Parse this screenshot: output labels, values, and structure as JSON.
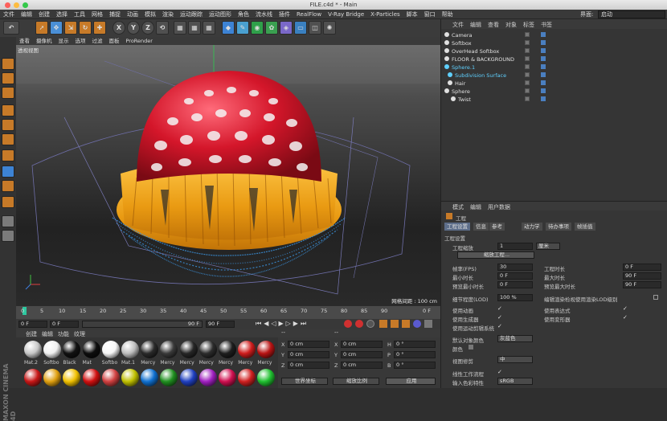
{
  "window": {
    "title": "FILE.c4d * - Main"
  },
  "menu": [
    "文件",
    "编辑",
    "创建",
    "选择",
    "工具",
    "网格",
    "捕捉",
    "动画",
    "模拟",
    "渲染",
    "运动跟踪",
    "运动图形",
    "角色",
    "流水线",
    "插件",
    "RealFlow",
    "V-Ray Bridge",
    "X-Particles",
    "脚本",
    "窗口",
    "帮助"
  ],
  "layout": {
    "label": "界面:",
    "value": "启动"
  },
  "viewport": {
    "menu": [
      "查看",
      "摄像机",
      "显示",
      "选项",
      "过滤",
      "面板",
      "ProRender"
    ],
    "name": "透视视图",
    "grid_label": "网格间距 : 100 cm"
  },
  "timeline": {
    "ticks": [
      "0",
      "5",
      "10",
      "15",
      "20",
      "25",
      "30",
      "35",
      "40",
      "45",
      "50",
      "55",
      "60",
      "65",
      "70",
      "75",
      "80",
      "85",
      "90"
    ],
    "end": "0 F"
  },
  "transport": {
    "start": "0 F",
    "current": "0 F",
    "end": "90 F",
    "end2": "90 F"
  },
  "materials": {
    "menu": [
      "创建",
      "编辑",
      "功能",
      "纹理"
    ],
    "items": [
      {
        "name": "Mat.2",
        "color": "#c8c8c8"
      },
      {
        "name": "Softbo",
        "color": "#f0f0f0"
      },
      {
        "name": "Black",
        "color": "#111111"
      },
      {
        "name": "Mat",
        "color": "#0d0d0d"
      },
      {
        "name": "Softbo",
        "color": "#f6f6f6"
      },
      {
        "name": "Mat.1",
        "color": "#bdbdbd"
      },
      {
        "name": "Mercy",
        "color": "#2a2a2a"
      },
      {
        "name": "Mercy",
        "color": "#3a3a3a"
      },
      {
        "name": "Mercy",
        "color": "#262626"
      },
      {
        "name": "Mercy",
        "color": "#2c2c2c"
      },
      {
        "name": "Mercy",
        "color": "#1e1e1e"
      },
      {
        "name": "Mercy",
        "color": "#d01d1d"
      },
      {
        "name": "Mercy",
        "color": "#b91414"
      }
    ],
    "row2": [
      "#c81717",
      "#e0a010",
      "#f0c000",
      "#d01010",
      "#d04040",
      "#c0c000",
      "#1070d0",
      "#209020",
      "#2040c0",
      "#a020c0",
      "#d01050",
      "#d02020",
      "#20c030"
    ],
    "brand": "MAXON CINEMA 4D"
  },
  "coords": {
    "header": [
      "--",
      "--"
    ],
    "rows": [
      {
        "a": "X",
        "av": "0 cm",
        "b": "X",
        "bv": "0 cm",
        "c": "H",
        "cv": "0 °"
      },
      {
        "a": "Y",
        "av": "0 cm",
        "b": "Y",
        "bv": "0 cm",
        "c": "P",
        "cv": "0 °"
      },
      {
        "a": "Z",
        "av": "0 cm",
        "b": "Z",
        "bv": "0 cm",
        "c": "B",
        "cv": "0 °"
      }
    ],
    "dropdown1": "世界坐标",
    "dropdown2": "缩放比例",
    "apply": "应用"
  },
  "objects": {
    "menu": [
      "文件",
      "编辑",
      "查看",
      "对象",
      "标签",
      "书签"
    ],
    "items": [
      {
        "name": "Camera",
        "color": "#e0e0e0"
      },
      {
        "name": "Softbox",
        "color": "#e0e0e0"
      },
      {
        "name": "OverHead Softbox",
        "color": "#e0e0e0"
      },
      {
        "name": "FLOOR & BACKGROUND",
        "color": "#e0e0e0"
      },
      {
        "name": "Sphere.1",
        "color": "#5fd0ff"
      },
      {
        "name": "Subdivision Surface",
        "color": "#5fd0ff"
      },
      {
        "name": "Hair",
        "color": "#e0e0e0"
      },
      {
        "name": "Sphere",
        "color": "#e0e0e0"
      },
      {
        "name": "Twist",
        "color": "#e0e0e0"
      }
    ]
  },
  "attributes": {
    "menu": [
      "模式",
      "编辑",
      "用户数据"
    ],
    "section": "工程",
    "tabs": [
      "工程设置",
      "信息",
      "参考",
      "动力学",
      "待办事项",
      "帧插值"
    ],
    "group": "工程设置",
    "scale_label": "工程缩放",
    "scale_value": "1",
    "scale_unit": "厘米",
    "scale_button": "缩放工程...",
    "fps_label": "帧率(FPS)",
    "fps_value": "30",
    "length_label": "工程时长",
    "length_value": "0 F",
    "min_label": "最小时长",
    "min_value": "0 F",
    "max_label": "最大时长",
    "max_value": "90 F",
    "pmin_label": "预览最小时长",
    "pmin_value": "0 F",
    "pmax_label": "预览最大时长",
    "pmax_value": "90 F",
    "lod_label": "细节程度(LOD)",
    "lod_value": "100 %",
    "lod_render": "编辑渲染检视使用渲染LOD级别",
    "anim": "使用动画",
    "expr": "使用表达式",
    "gen": "使用生成器",
    "deform": "使用变形器",
    "motion": "使用运动剪辑系统",
    "defcolor_label": "默认对象颜色",
    "defcolor_value": "灰蓝色",
    "color_label": "颜色",
    "clip_label": "视图修剪",
    "clip_value": "中",
    "linear_label": "线性工作流程",
    "input_label": "输入色彩特性",
    "input_value": "sRGB"
  }
}
